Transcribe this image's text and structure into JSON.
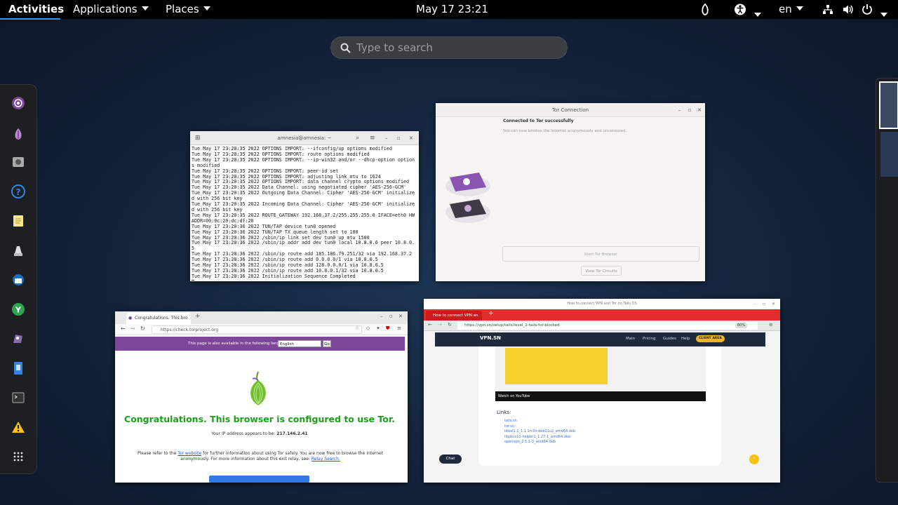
{
  "topbar": {
    "activities": "Activities",
    "applications": "Applications",
    "places": "Places",
    "clock": "May 17  23:21",
    "lang": "en"
  },
  "search": {
    "placeholder": "Type to search"
  },
  "dash": {
    "icons": [
      "tor-browser-icon",
      "onion-circuits-icon",
      "screenshot-icon",
      "help-icon",
      "text-editor-icon",
      "files-icon",
      "thunderbird-icon",
      "electrum-icon",
      "pidgin-icon",
      "document-icon",
      "terminal-icon",
      "unsafe-browser-warning-icon",
      "show-applications-icon"
    ]
  },
  "terminal": {
    "title": "amnesia@amnesia: ~",
    "lines": [
      "Tue May 17 23:20:35 2022 OPTIONS IMPORT: --ifconfig/up options modified",
      "Tue May 17 23:20:35 2022 OPTIONS IMPORT: route options modified",
      "Tue May 17 23:20:35 2022 OPTIONS IMPORT: --ip-win32 and/or --dhcp-option options modified",
      "Tue May 17 23:20:35 2022 OPTIONS IMPORT: peer-id set",
      "Tue May 17 23:20:35 2022 OPTIONS IMPORT: adjusting link_mtu to 1624",
      "Tue May 17 23:20:35 2022 OPTIONS IMPORT: data channel crypto options modified",
      "Tue May 17 23:20:35 2022 Data Channel: using negotiated cipher 'AES-256-GCM'",
      "Tue May 17 23:20:35 2022 Outgoing Data Channel: Cipher 'AES-256-GCM' initialized with 256 bit key",
      "Tue May 17 23:20:35 2022 Incoming Data Channel: Cipher 'AES-256-GCM' initialized with 256 bit key",
      "Tue May 17 23:20:35 2022 ROUTE_GATEWAY 192.168.37.2/255.255.255.0 IFACE=eth0 HWADDR=00:0c:29:dc:df:20",
      "Tue May 17 23:20:36 2022 TUN/TAP device tun0 opened",
      "Tue May 17 23:20:36 2022 TUN/TAP TX queue length set to 100",
      "Tue May 17 23:20:36 2022 /sbin/ip link set dev tun0 up mtu 1500",
      "Tue May 17 23:20:36 2022 /sbin/ip addr add dev tun0 local 10.8.0.6 peer 10.8.0.5",
      "Tue May 17 23:20:36 2022 /sbin/ip route add 185.186.79.251/32 via 192.168.37.2",
      "Tue May 17 23:20:36 2022 /sbin/ip route add 0.0.0.0/1 via 10.8.0.5",
      "Tue May 17 23:20:36 2022 /sbin/ip route add 128.0.0.0/1 via 10.8.0.5",
      "Tue May 17 23:20:36 2022 /sbin/ip route add 10.8.0.1/32 via 10.8.0.5",
      "Tue May 17 23:20:36 2022 Initialization Sequence Completed"
    ]
  },
  "tor_connection": {
    "title": "Tor Connection",
    "status": "Connected to Tor successfully",
    "message": "You can now browse the Internet anonymously and uncensored.",
    "start_button": "Start Tor Browser",
    "circuits_button": "View Tor Circuits"
  },
  "tor_check": {
    "tab_title": "Congratulations. This bro",
    "url": "https://check.torproject.org",
    "lang_note": "This page is also available in the following languages:",
    "lang_select": "English",
    "go_button": "Go",
    "headline": "Congratulations. This browser is configured to use Tor.",
    "ip_label": "Your IP address appears to be:",
    "ip": "217.146.2.41",
    "refer_pre": "Please refer to the",
    "tor_website": "Tor website",
    "refer_post": "for further information about using Tor safely. You are now free to browse the Internet anonymously. For more information about this exit relay, see:",
    "relay_search": "Relay Search."
  },
  "vpn": {
    "window_title": "How to connect VPN and Tor on Tails OS",
    "tab_title": "How to connect VPN an",
    "url": "https://vpn.sn/setup/tails/level_2-tails-for-blocked",
    "zoom": "80%",
    "logo": "VPN.SN",
    "nav": [
      "Main",
      "Pricing",
      "Guides",
      "Help"
    ],
    "client_area": "CLIENT AREA",
    "video_caption": "Watch on YouTube",
    "links_heading": "Links:",
    "links": [
      "tails.sn",
      "tor.sn",
      "libssl1.1_1.1.1n-0+deb11u2_amd64.deb",
      "libpkcs11-helper1_1.27-1_amd64.deb",
      "openvpn_2.5.1-3_amd64.deb"
    ],
    "chat": "Chat"
  },
  "colors": {
    "accent": "#3d8ee8",
    "tor_purple": "#7d4698",
    "tor_green": "#1d9f1c",
    "vpn_red": "#e22d2d"
  }
}
